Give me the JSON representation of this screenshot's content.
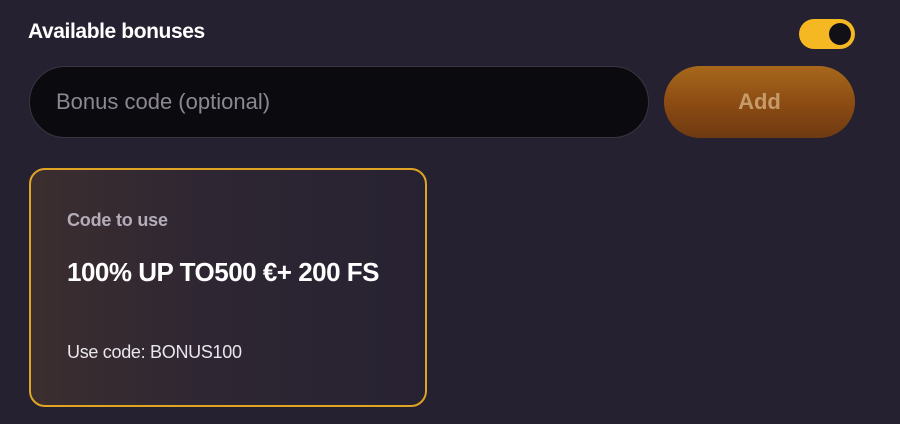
{
  "header": {
    "title": "Available bonuses",
    "toggle_state": "on"
  },
  "bonus_code": {
    "placeholder": "Bonus code (optional)",
    "value": "",
    "add_label": "Add"
  },
  "cards": [
    {
      "subtitle": "Code to use",
      "title": "100% UP TO500 €+ 200 FS",
      "code_text": "Use code: BONUS100"
    }
  ],
  "colors": {
    "background": "#262130",
    "accent": "#f5b722",
    "card_border": "#e0a423",
    "add_button": "#8a4a12"
  }
}
